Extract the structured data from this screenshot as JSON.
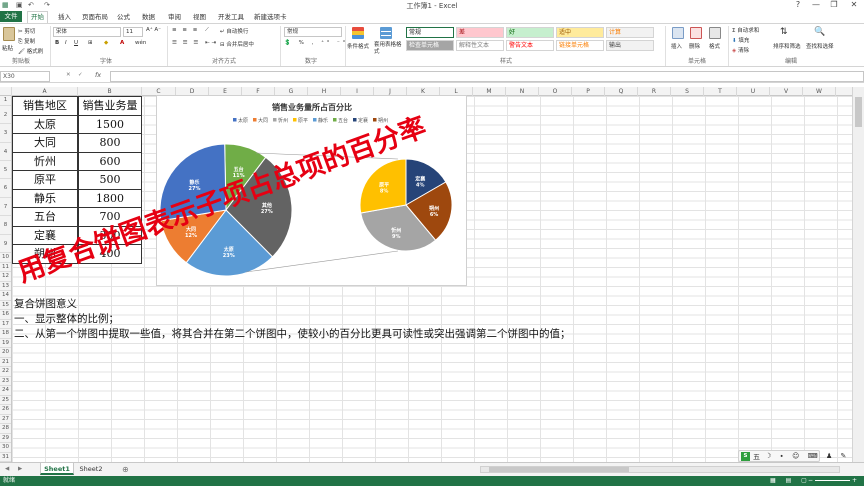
{
  "window": {
    "title": "工作簿1 - Excel",
    "controls": [
      "?",
      "—",
      "❐",
      "✕"
    ]
  },
  "tabs": {
    "file": "文件",
    "items": [
      "开始",
      "插入",
      "页面布局",
      "公式",
      "数据",
      "审阅",
      "视图",
      "开发工具",
      "新建选项卡"
    ]
  },
  "ribbon": {
    "clipboard": {
      "paste": "粘贴",
      "cut": "剪切",
      "copy": "复制",
      "format_painter": "格式刷",
      "label": "剪贴板"
    },
    "font": {
      "name": "宋体",
      "size": "11",
      "label": "字体"
    },
    "alignment": {
      "wrap": "自动换行",
      "merge": "合并后居中",
      "label": "对齐方式"
    },
    "number": {
      "format": "常规",
      "label": "数字"
    },
    "styles": {
      "cond_format": "条件格式",
      "table_format": "套用表格格式",
      "cells": [
        {
          "text": "常规",
          "bg": "#ffffff",
          "fg": "#222222"
        },
        {
          "text": "差",
          "bg": "#ffc7ce",
          "fg": "#9c0006"
        },
        {
          "text": "好",
          "bg": "#c6efce",
          "fg": "#006100"
        },
        {
          "text": "适中",
          "bg": "#ffeb9c",
          "fg": "#9c5700"
        },
        {
          "text": "计算",
          "bg": "#f2f2f2",
          "fg": "#fa7d00"
        },
        {
          "text": "检查单元格",
          "bg": "#a5a5a5",
          "fg": "#ffffff"
        },
        {
          "text": "解释性文本",
          "bg": "#ffffff",
          "fg": "#7f7f7f"
        },
        {
          "text": "警告文本",
          "bg": "#ffffff",
          "fg": "#ff0000"
        },
        {
          "text": "链接单元格",
          "bg": "#ffffff",
          "fg": "#fa7d00"
        },
        {
          "text": "输出",
          "bg": "#f2f2f2",
          "fg": "#3f3f3f"
        }
      ],
      "label": "样式"
    },
    "cells_group": {
      "insert": "插入",
      "delete": "删除",
      "format": "格式",
      "label": "单元格"
    },
    "editing": {
      "autosum": "自动求和",
      "fill": "填充",
      "clear": "清除",
      "sort": "排序和筛选",
      "find": "查找和选择",
      "label": "编辑"
    }
  },
  "formula_bar": {
    "name_box": "X30",
    "fx": "fx",
    "content": ""
  },
  "grid": {
    "columns": [
      "A",
      "B",
      "C",
      "D",
      "E",
      "F",
      "G",
      "H",
      "I",
      "J",
      "K",
      "L",
      "M",
      "N",
      "O",
      "P",
      "Q",
      "R",
      "S",
      "T",
      "U",
      "V",
      "W"
    ],
    "rows": [
      "1",
      "2",
      "3",
      "4",
      "5",
      "6",
      "7",
      "8",
      "9",
      "10",
      "11",
      "12",
      "13",
      "14",
      "15",
      "16",
      "17",
      "18",
      "19",
      "20",
      "21",
      "22",
      "23",
      "24",
      "25",
      "26",
      "27",
      "28",
      "29",
      "30",
      "31"
    ]
  },
  "table": {
    "headers": [
      "销售地区",
      "销售业务量"
    ],
    "rows": [
      [
        "太原",
        "1500"
      ],
      [
        "大同",
        "800"
      ],
      [
        "忻州",
        "600"
      ],
      [
        "原平",
        "500"
      ],
      [
        "静乐",
        "1800"
      ],
      [
        "五台",
        "700"
      ],
      [
        "定襄",
        "300"
      ],
      [
        "朔州",
        "400"
      ]
    ]
  },
  "notes": {
    "title": "复合饼图意义",
    "line1": "一、显示整体的比例；",
    "line2": "二、从第一个饼图中提取一些值，将其合并在第二个饼图中，使较小的百分比更具可读性或突出强调第二个饼图中的值；"
  },
  "overlay_text": "用复合饼图表示子项占总项的百分率",
  "sheets": {
    "tabs": [
      "Sheet1",
      "Sheet2"
    ],
    "active": "Sheet1"
  },
  "status": {
    "ready": "就绪",
    "ime": "五"
  },
  "chart_data": {
    "type": "pie",
    "title": "销售业务量所占百分比",
    "legend": [
      "太原",
      "大同",
      "忻州",
      "原平",
      "静乐",
      "五台",
      "定襄",
      "朔州"
    ],
    "legend_position": "top",
    "colors": [
      "#4472c4",
      "#ed7d31",
      "#a5a5a5",
      "#ffc000",
      "#5b9bd5",
      "#70ad47",
      "#264478",
      "#9e480e"
    ],
    "primary": [
      {
        "name": "太原",
        "value": 1500,
        "label": "23%",
        "color": "#5b9bd5"
      },
      {
        "name": "大同",
        "value": 800,
        "label": "12%",
        "color": "#ed7d31"
      },
      {
        "name": "静乐",
        "value": 1800,
        "label": "27%",
        "color": "#4472c4"
      },
      {
        "name": "五台",
        "value": 700,
        "label": "11%",
        "color": "#70ad47"
      },
      {
        "name": "其他",
        "value": 1800,
        "label": "27%",
        "color": "#636363"
      }
    ],
    "secondary": [
      {
        "name": "定襄",
        "value": 300,
        "label": "4%",
        "color": "#264478"
      },
      {
        "name": "朔州",
        "value": 400,
        "label": "6%",
        "color": "#9e480e"
      },
      {
        "name": "忻州",
        "value": 600,
        "label": "9%",
        "color": "#a5a5a5"
      },
      {
        "name": "原平",
        "value": 500,
        "label": "8%",
        "color": "#ffc000"
      }
    ]
  }
}
